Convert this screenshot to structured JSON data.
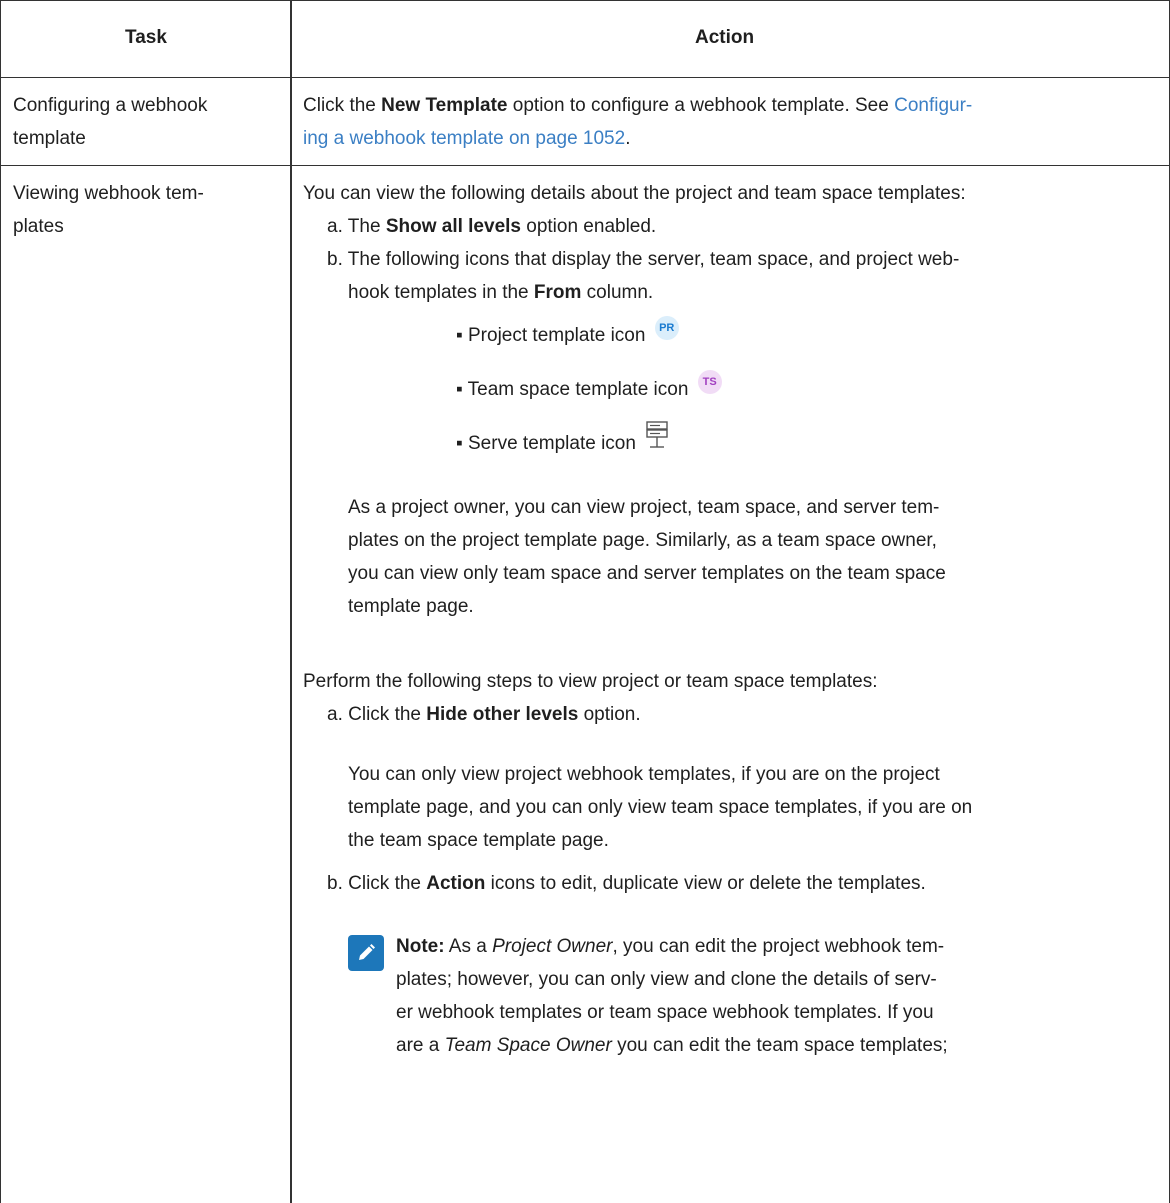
{
  "header": {
    "task": "Task",
    "action": "Action"
  },
  "row1": {
    "task_line1": "Configuring a webhook",
    "task_line2": "template",
    "a_pre": "Click the ",
    "a_bold": "New Template",
    "a_post": " option to configure a webhook template. See ",
    "a_link1": "Configur-",
    "a_link2": "ing a webhook template on page 1052",
    "a_end": "."
  },
  "row2": {
    "task_line1": "Viewing webhook tem-",
    "task_line2": "plates",
    "intro": "You can view the following details about the project and team space templates:",
    "a_pre": "a. The ",
    "a_bold": "Show all levels",
    "a_post": " option enabled.",
    "b_line1": "b. The following icons that display the server, team space, and project web-",
    "b_line2_pre": "hook templates in the ",
    "b_line2_bold": "From",
    "b_line2_post": " column.",
    "bullets": {
      "pr_label": "▪ Project template icon",
      "pr_badge": "PR",
      "ts_label": "▪ Team space template icon",
      "ts_badge": "TS",
      "srv_label": "▪ Serve template icon"
    },
    "para1": [
      "As a project owner, you can view project, team space, and server tem-",
      "plates on the project template page. Similarly, as a team space owner,",
      "you can view only team space and server templates on the team space",
      "template page."
    ],
    "steps_intro": "Perform the following steps to view project or team space templates:",
    "step_a_pre": "a. Click the ",
    "step_a_bold": "Hide other levels",
    "step_a_post": " option.",
    "para2": [
      "You can only view project webhook templates, if you are on the project",
      "template page, and you can only view team space templates, if you are on",
      "the team space template page."
    ],
    "step_b_pre": "b. Click the ",
    "step_b_bold": "Action",
    "step_b_post": " icons to edit, duplicate view or delete the templates.",
    "note": {
      "label": "Note:",
      "l1_a": " As a ",
      "l1_i": "Project Owner",
      "l1_b": ", you can edit the project webhook tem-",
      "l2": "plates; however, you can only view and clone the details of serv-",
      "l3": "er webhook templates or team space webhook templates. If you",
      "l4_a": "are a ",
      "l4_i": "Team Space Owner",
      "l4_b": " you can edit the team space templates;"
    }
  }
}
